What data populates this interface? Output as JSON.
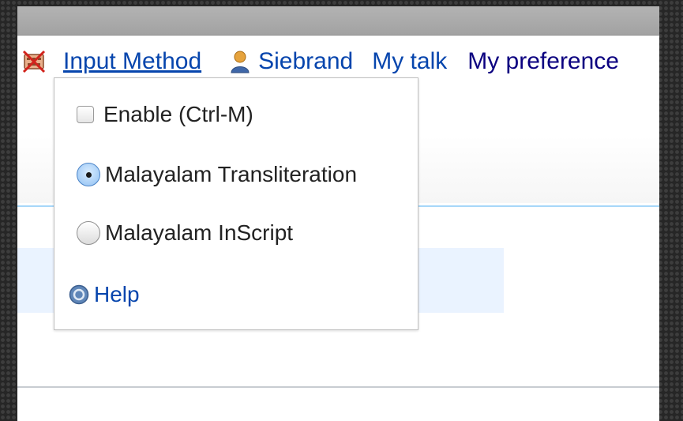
{
  "personal_tools": {
    "input_method_label": "Input Method",
    "username": "Siebrand",
    "talk_label": "My talk",
    "preferences_label": "My preference"
  },
  "ime_menu": {
    "enable_label": "Enable (Ctrl-M)",
    "enable_checked": false,
    "options": [
      {
        "label": "Malayalam Transliteration",
        "selected": true
      },
      {
        "label": "Malayalam InScript",
        "selected": false
      }
    ],
    "help_label": "Help"
  },
  "icons": {
    "input_method": "keyboard-crossed-icon",
    "user": "user-icon",
    "help": "help-icon"
  }
}
